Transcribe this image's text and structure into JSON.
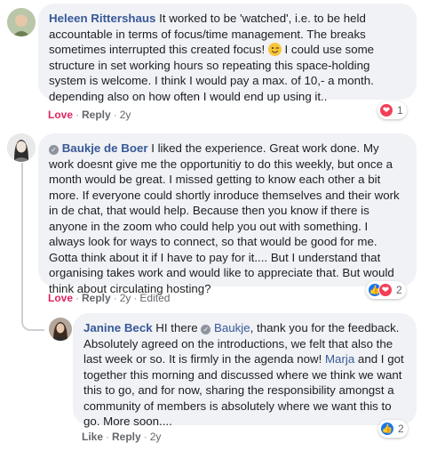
{
  "comments": [
    {
      "author": "Heleen Rittershaus",
      "text_before_emoji": " It worked to be 'watched', i.e. to be held accountable in terms of focus/time management. The breaks sometimes interrupted this created focus! ",
      "emoji": "winking-face-emoji",
      "text_after_emoji": " I could use some structure in set working hours so repeating this space-holding system is welcome. I think I would pay a max. of 10,- a month. depending also on how often I would end up using it..",
      "action_love": "Love",
      "action_reply": "Reply",
      "time": "2y",
      "reaction_icons": [
        "heart-reaction-icon"
      ],
      "reaction_count": "1"
    },
    {
      "author": "Baukje de Boer",
      "text": " I liked the experience. Great work done. My work doesnt give me the opportunitiy to do this weekly, but once a month would be great. I missed getting to know each other a bit more. If everyone could shortly inroduce themselves and their work in de chat, that would help. Because then you know if there is anyone in the zoom who could help you out with something. I always look for ways to connect, so that would be good for me. Gotta think about it if I have to pay for it.... But I understand that organising takes work and would like to appreciate that. But would think about circulating hosting?",
      "action_love": "Love",
      "action_reply": "Reply",
      "time": "2y",
      "edited": "Edited",
      "reaction_icons": [
        "like-reaction-icon",
        "heart-reaction-icon"
      ],
      "reaction_count": "2"
    },
    {
      "author": "Janine Beck",
      "text_intro": " HI there ",
      "mention_1": "Baukje",
      "text_mid": ", thank you for the feedback. Absolutely agreed on the introductions, we felt that also the last week or so. It is firmly in the agenda now! ",
      "mention_2": "Marja",
      "text_end": " and I got together this morning and discussed where we think we want this to go, and for now, sharing the responsibility amongst a community of members is absolutely where we want this to go. More soon....",
      "action_like": "Like",
      "action_reply": "Reply",
      "time": "2y",
      "reaction_icons": [
        "like-reaction-icon"
      ],
      "reaction_count": "2"
    }
  ],
  "separator": "·",
  "colors": {
    "author": "#385898",
    "bubble": "#f0f2f5",
    "love": "#e0245e",
    "like": "#1877f2",
    "heart": "#f33e58"
  }
}
